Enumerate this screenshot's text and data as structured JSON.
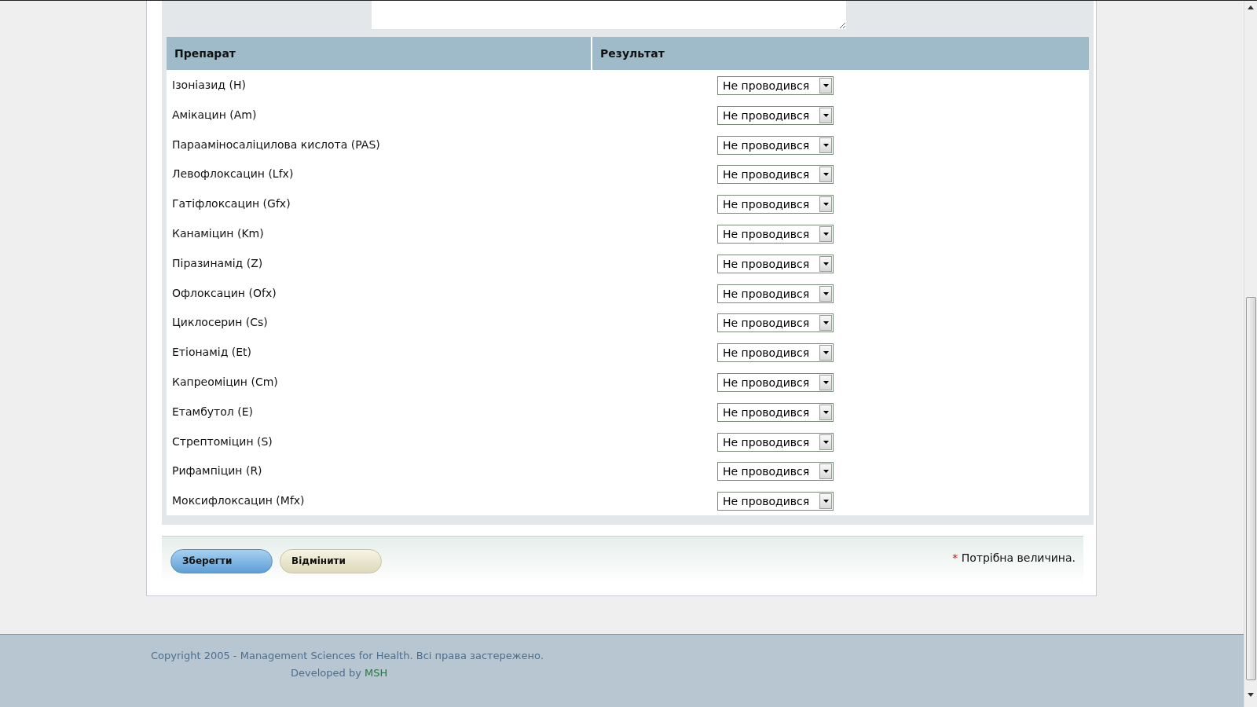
{
  "table": {
    "columns": [
      "Препарат",
      "Результат"
    ],
    "rows": [
      {
        "drug": "Ізоніазид (H)",
        "result": "Не проводився"
      },
      {
        "drug": "Амікацин (Am)",
        "result": "Не проводився"
      },
      {
        "drug": "Парааміносаліцилова кислота (PAS)",
        "result": "Не проводився"
      },
      {
        "drug": "Левофлоксацин (Lfx)",
        "result": "Не проводився"
      },
      {
        "drug": "Гатіфлоксацин (Gfx)",
        "result": "Не проводився"
      },
      {
        "drug": "Канаміцин (Km)",
        "result": "Не проводився"
      },
      {
        "drug": "Піразинамід (Z)",
        "result": "Не проводився"
      },
      {
        "drug": "Офлоксацин (Ofx)",
        "result": "Не проводився"
      },
      {
        "drug": "Циклосерин (Cs)",
        "result": "Не проводився"
      },
      {
        "drug": "Етіонамід (Et)",
        "result": "Не проводився"
      },
      {
        "drug": "Капреоміцин (Cm)",
        "result": "Не проводився"
      },
      {
        "drug": "Етамбутол (E)",
        "result": "Не проводився"
      },
      {
        "drug": "Стрептоміцин (S)",
        "result": "Не проводився"
      },
      {
        "drug": "Рифампіцин (R)",
        "result": "Не проводився"
      },
      {
        "drug": "Моксифлоксацин (Mfx)",
        "result": "Не проводився"
      }
    ]
  },
  "buttons": {
    "save": "Зберегти",
    "cancel": "Відмінити"
  },
  "required_note": {
    "mark": "*",
    "text": "Потрібна величина."
  },
  "footer": {
    "copyright": "Copyright 2005 - Management Sciences for Health. Всі права застережено.",
    "developed_by": "Developed by",
    "link": "MSH"
  }
}
